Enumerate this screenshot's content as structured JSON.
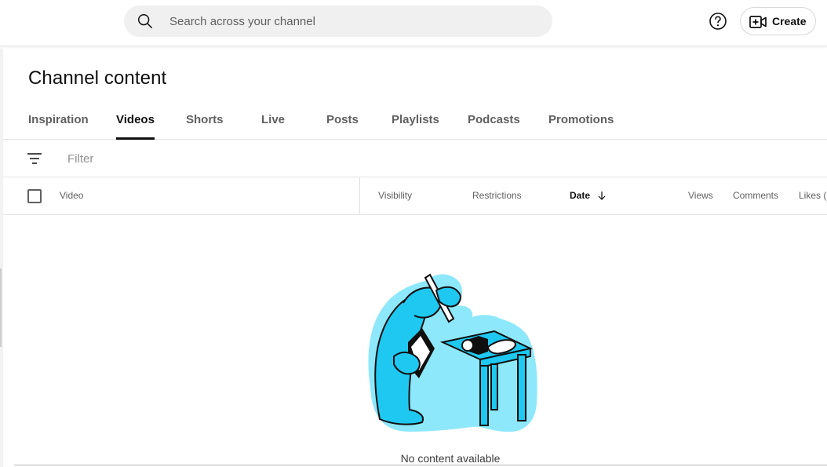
{
  "header": {
    "search_placeholder": "Search across your channel",
    "help_icon": "help-circle-icon",
    "create_label": "Create",
    "create_icon": "video-add-icon"
  },
  "page": {
    "title": "Channel content"
  },
  "tabs": [
    {
      "label": "Inspiration",
      "active": false
    },
    {
      "label": "Videos",
      "active": true
    },
    {
      "label": "Shorts",
      "active": false
    },
    {
      "label": "Live",
      "active": false
    },
    {
      "label": "Posts",
      "active": false
    },
    {
      "label": "Playlists",
      "active": false
    },
    {
      "label": "Podcasts",
      "active": false
    },
    {
      "label": "Promotions",
      "active": false
    }
  ],
  "filter": {
    "icon": "filter-lines-icon",
    "placeholder": "Filter"
  },
  "table": {
    "columns": {
      "video": "Video",
      "visibility": "Visibility",
      "restrictions": "Restrictions",
      "date": "Date",
      "views": "Views",
      "comments": "Comments",
      "likes": "Likes ("
    },
    "sorted_by": "date",
    "sort_icon": "arrow-down-icon"
  },
  "empty_state": {
    "message": "No content available",
    "illustration": "inspector-with-magnifier-illustration"
  },
  "colors": {
    "text_primary": "#0f0f0f",
    "text_secondary": "#606060",
    "search_bg": "#f0f0f0",
    "illustration_cyan": "#1fc8f0",
    "illustration_halo": "#8ee8fb"
  }
}
